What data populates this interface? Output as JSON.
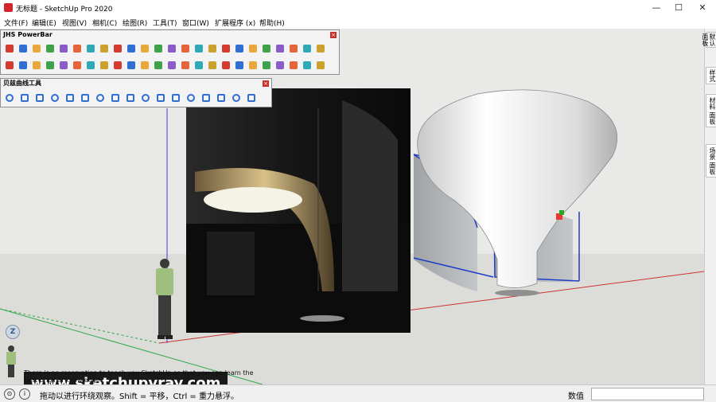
{
  "window": {
    "title": "无标题 - SketchUp Pro 2020",
    "minimize": "—",
    "maximize": "☐",
    "close": "✕"
  },
  "menu": [
    "文件(F)",
    "编辑(E)",
    "视图(V)",
    "相机(C)",
    "绘图(R)",
    "工具(T)",
    "窗口(W)",
    "扩展程序 (x)",
    "帮助(H)"
  ],
  "toolbars": {
    "jhs": {
      "title": "JHS PowerBar",
      "row1_count": 24,
      "row2_count": 24
    },
    "bezier": {
      "title": "贝兹曲线工具",
      "count": 17
    }
  },
  "tray_tabs": [
    "默认面板",
    "样式",
    "材料 面板",
    "场景 面板"
  ],
  "axis_icon_label": "Z",
  "banner": {
    "text": "www.sketchupvray.com"
  },
  "caption": "There is no reservation to teach you SketchUp so that you can learn the best original knowledge.",
  "status": {
    "text": "拖动以进行环绕观察。Shift = 平移，Ctrl = 重力悬浮。",
    "measure_label": "数值",
    "measure_value": ""
  },
  "colors": {
    "selection": "#1f3cc6",
    "axis_red": "#cc3333",
    "axis_green": "#2fa84a",
    "axis_blue": "#3a3ad6"
  }
}
